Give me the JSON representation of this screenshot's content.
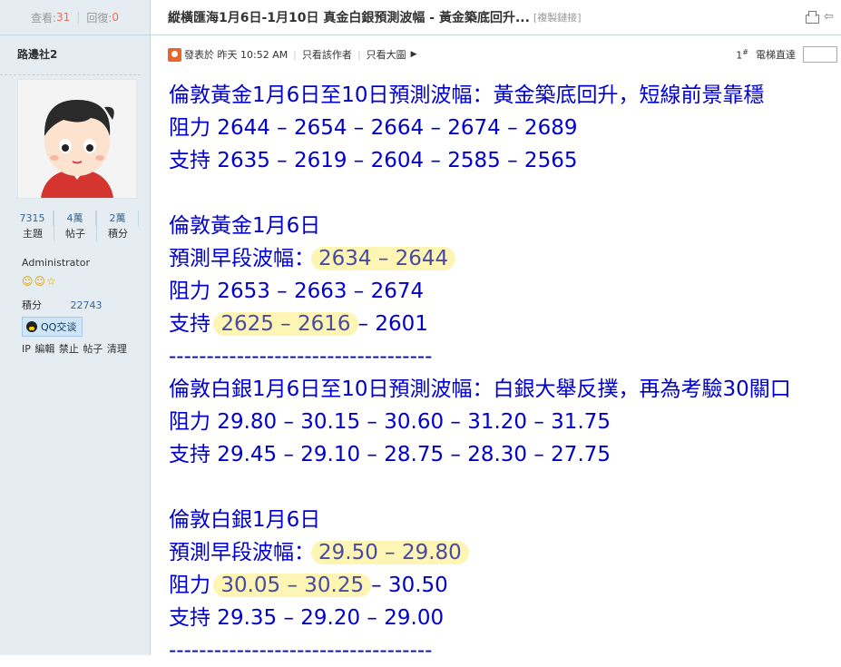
{
  "sidebar": {
    "views_label": "查看:",
    "views_value": "31",
    "replies_label": "回復:",
    "replies_value": "0",
    "author": "路邊社2",
    "stats": [
      {
        "value": "7315",
        "label": "主題"
      },
      {
        "value": "4萬",
        "label": "帖子"
      },
      {
        "value": "2萬",
        "label": "積分"
      }
    ],
    "role": "Administrator",
    "points_label": "積分",
    "points_value": "22743",
    "qq_label": "QQ交谈",
    "admin_links": [
      "IP",
      "編輯",
      "禁止",
      "帖子",
      "清理"
    ]
  },
  "header": {
    "title": "縱橫匯海1月6日-1月10日 真金白銀預測波幅 - 黃金築底回升...",
    "copy_link": "[複製鏈接]"
  },
  "meta": {
    "posted": "發表於 昨天 10:52 AM",
    "author_only": "只看該作者",
    "big_image": "只看大圖",
    "floor": "1",
    "floor_sup": "#",
    "jump_label": "電梯直達"
  },
  "post": {
    "lines": [
      {
        "text": "倫敦黃金1月6日至10日預測波幅：黃金築底回升，短線前景靠穩"
      },
      {
        "text": "阻力 2644 – 2654 – 2664 – 2674 – 2689"
      },
      {
        "text": "支持 2635 – 2619 – 2604 – 2585 – 2565"
      },
      {
        "text": ""
      },
      {
        "text": "倫敦黃金1月6日"
      },
      {
        "pre": "預測早段波幅：",
        "hl": "2634 – 2644",
        "post": ""
      },
      {
        "text": "阻力 2653 – 2663 – 2674"
      },
      {
        "pre": "支持 ",
        "hl": "2625 – 2616",
        "post": "– 2601"
      },
      {
        "text": "-----------------------------------"
      },
      {
        "text": "倫敦白銀1月6日至10日預測波幅：白銀大舉反撲，再為考驗30關口"
      },
      {
        "text": "阻力 29.80 – 30.15 – 30.60 – 31.20 – 31.75"
      },
      {
        "text": "支持 29.45 – 29.10 – 28.75 – 28.30 – 27.75"
      },
      {
        "text": ""
      },
      {
        "text": "倫敦白銀1月6日"
      },
      {
        "pre": "預測早段波幅：",
        "hl": "29.50 – 29.80",
        "post": ""
      },
      {
        "pre": "阻力 ",
        "hl": "30.05 – 30.25",
        "post": "– 30.50"
      },
      {
        "text": "支持 29.35 – 29.20 – 29.00"
      },
      {
        "text": "-----------------------------------"
      }
    ]
  },
  "colors": {
    "post_text": "#0000cc",
    "highlight": "#fdf5b3",
    "sidebar_bg": "#e5edf2",
    "stat_accent": "#f26c4f"
  }
}
